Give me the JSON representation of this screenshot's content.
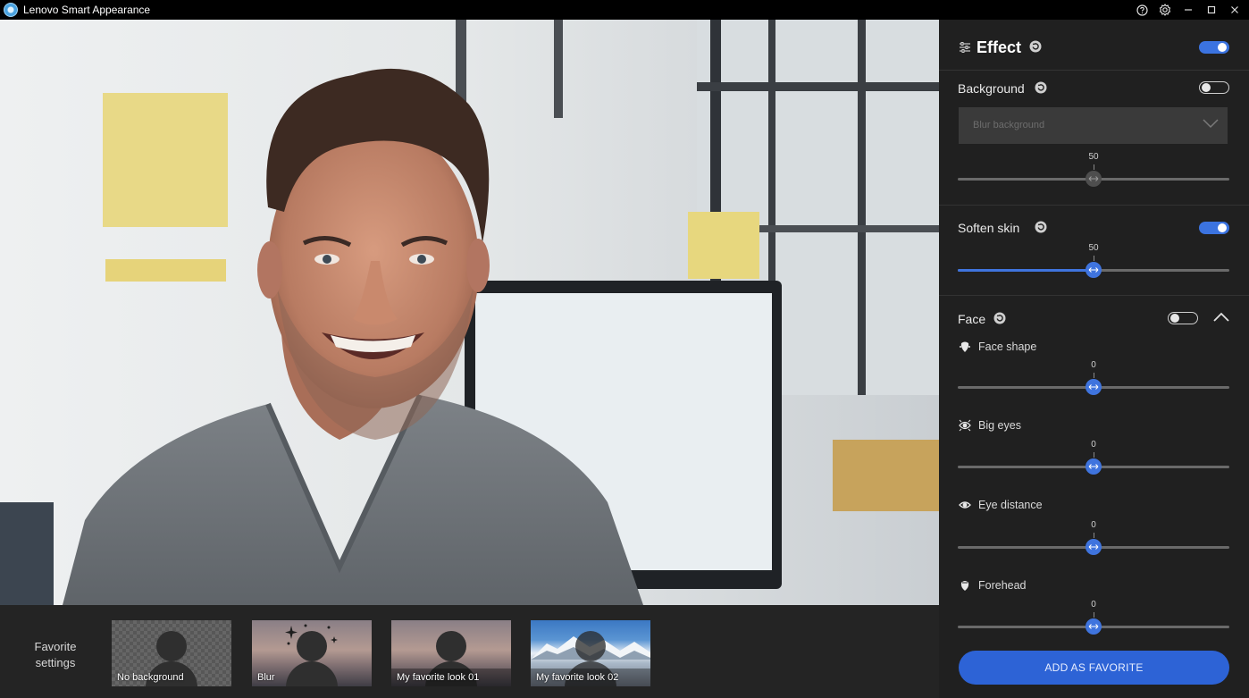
{
  "window": {
    "title": "Lenovo Smart Appearance",
    "controls": [
      "help-icon",
      "settings-icon",
      "minimize-icon",
      "maximize-icon",
      "close-icon"
    ]
  },
  "favorites": {
    "label_line1": "Favorite",
    "label_line2": "settings",
    "items": [
      {
        "name": "No background",
        "thumbnail": "transparent"
      },
      {
        "name": "Blur",
        "thumbnail": "blur"
      },
      {
        "name": "My favorite look 01",
        "thumbnail": "sunset"
      },
      {
        "name": "My favorite look 02",
        "thumbnail": "snowy-mountains"
      }
    ]
  },
  "panel": {
    "effect": {
      "title": "Effect",
      "enabled": true
    },
    "background": {
      "title": "Background",
      "enabled": false,
      "dropdown_value": "Blur background",
      "slider": {
        "value": 50,
        "min": 0,
        "max": 100,
        "label": "50"
      }
    },
    "soften_skin": {
      "title": "Soften skin",
      "enabled": true,
      "slider": {
        "value": 50,
        "min": 0,
        "max": 100,
        "label": "50"
      }
    },
    "face": {
      "title": "Face",
      "enabled": false,
      "expanded": true,
      "controls": [
        {
          "label": "Face shape",
          "icon": "face-shape-icon",
          "value": 0,
          "value_label": "0"
        },
        {
          "label": "Big eyes",
          "icon": "eye-icon",
          "value": 0,
          "value_label": "0"
        },
        {
          "label": "Eye distance",
          "icon": "eye-distance-icon",
          "value": 0,
          "value_label": "0"
        },
        {
          "label": "Forehead",
          "icon": "forehead-icon",
          "value": 0,
          "value_label": "0"
        }
      ]
    },
    "add_favorite_label": "ADD AS FAVORITE"
  },
  "colors": {
    "accent": "#3f74de",
    "panel_bg": "#202020",
    "titlebar_bg": "#000000"
  }
}
